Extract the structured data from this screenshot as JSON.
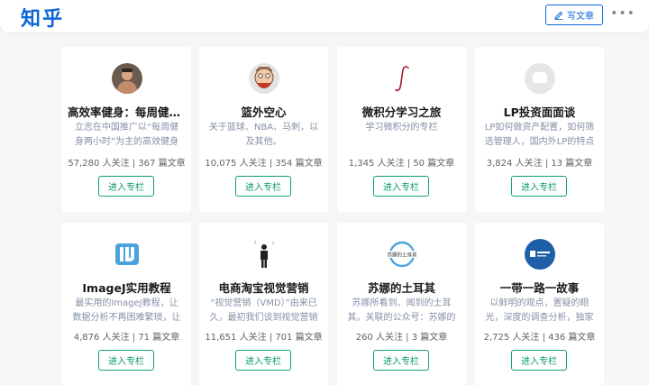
{
  "header": {
    "logo": "知乎",
    "write_label": "写文章",
    "more": "•••"
  },
  "columns": [
    {
      "title": "高效率健身：每周健身两小时",
      "desc": "立志在中国推广以“每周健身两小时”为主的高效健身理念",
      "followers": "57,280 人关注",
      "articles": "367 篇文章",
      "button": "进入专栏",
      "avatar": "fitness-avatar"
    },
    {
      "title": "篮外空心",
      "desc": "关于篮球、NBA、马刺，以及其他。",
      "followers": "10,075 人关注",
      "articles": "354 篇文章",
      "button": "进入专栏",
      "avatar": "basketball-avatar"
    },
    {
      "title": "微积分学习之旅",
      "desc": "学习微积分的专栏",
      "followers": "1,345 人关注",
      "articles": "50 篇文章",
      "button": "进入专栏",
      "avatar": "integral-avatar"
    },
    {
      "title": "LP投资面面谈",
      "desc": "LP如何做资产配置，如何筛选管理人，国内外LP的特点",
      "followers": "3,824 人关注",
      "articles": "13 篇文章",
      "button": "进入专栏",
      "avatar": "placeholder-avatar"
    },
    {
      "title": "ImageJ实用教程",
      "desc": "最实用的ImageJ教程，让数据分析不再困难繁琐，让科研更简单",
      "followers": "4,876 人关注",
      "articles": "71 篇文章",
      "button": "进入专栏",
      "avatar": "imagej-avatar"
    },
    {
      "title": "电商淘宝视觉营销",
      "desc": "“视觉营销（VMD）”由来已久，最初我们谈到视觉营销",
      "followers": "11,651 人关注",
      "articles": "701 篇文章",
      "button": "进入专栏",
      "avatar": "figure-avatar"
    },
    {
      "title": "苏娜的土耳其",
      "desc": "苏娜所看到、闻到的土耳其。关联的公众号：苏娜的土耳其",
      "followers": "260 人关注",
      "articles": "3 篇文章",
      "button": "进入专栏",
      "avatar": "turkey-avatar",
      "avatar_text": "苏娜的土耳其"
    },
    {
      "title": "一带一路一故事",
      "desc": "以鲜明的观点，置疑的眼光，深度的调查分析，独家的报道",
      "followers": "2,725 人关注",
      "articles": "436 篇文章",
      "button": "进入专栏",
      "avatar": "beltroad-avatar"
    }
  ]
}
